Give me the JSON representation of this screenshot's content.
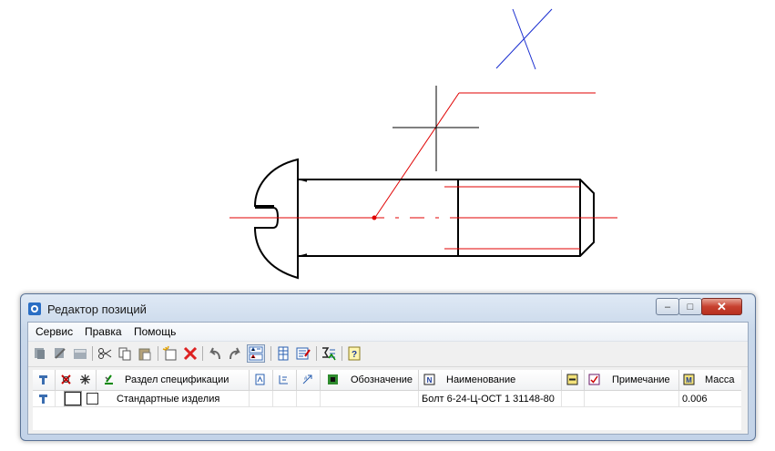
{
  "window": {
    "title": "Редактор позиций",
    "controls": {
      "minimize": "–",
      "maximize": "□",
      "close": "✕"
    }
  },
  "menu": [
    "Сервис",
    "Правка",
    "Помощь"
  ],
  "toolbar_icons": [
    "object-link-icon",
    "object-unlink-icon",
    "panel-icon",
    "cut-icon",
    "copy-icon",
    "paste-icon",
    "new-item-icon",
    "delete-icon",
    "undo-icon",
    "redo-icon",
    "sort-az-icon",
    "table-icon",
    "properties-icon",
    "sum-icon",
    "help-icon"
  ],
  "columns": {
    "section": "Раздел спецификации",
    "designation": "Обозначение",
    "name": "Наименование",
    "note": "Примечание",
    "mass": "Масса"
  },
  "header_icons": {
    "section": "blue-doc-icon",
    "designation": "green-square-icon",
    "name": "n-badge-icon",
    "note": "checkbox-icon",
    "mass": "m-badge-icon"
  },
  "rows": [
    {
      "section": "Стандартные изделия",
      "name": "Болт 6-24-Ц-ОСТ 1 31148-80",
      "mass": "0.006",
      "designation": "",
      "note": ""
    }
  ],
  "colors": {
    "drawing": "#000000",
    "axis": "#e00000",
    "cursor": "#1a2ed0",
    "accent": "#2a5fb0"
  }
}
